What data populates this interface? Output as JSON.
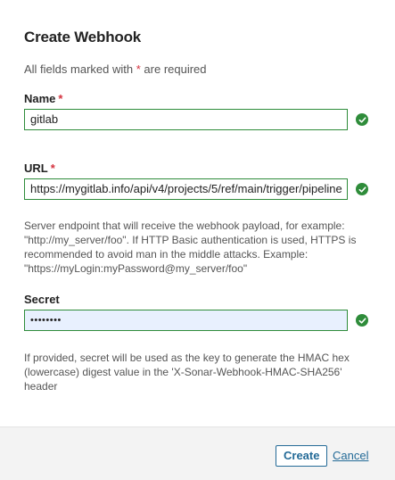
{
  "dialog": {
    "title": "Create Webhook",
    "required_note_prefix": "All fields marked with",
    "required_star": "*",
    "required_note_suffix": "are required"
  },
  "fields": {
    "name": {
      "label": "Name",
      "value": "gitlab",
      "valid_icon": "check-circle-icon"
    },
    "url": {
      "label": "URL",
      "value": "https://mygitlab.info/api/v4/projects/5/ref/main/trigger/pipeline",
      "help": "Server endpoint that will receive the webhook payload, for example: \"http://my_server/foo\". If HTTP Basic authentication is used, HTTPS is recommended to avoid man in the middle attacks. Example: \"https://myLogin:myPassword@my_server/foo\"",
      "valid_icon": "check-circle-icon"
    },
    "secret": {
      "label": "Secret",
      "value": "••••••••",
      "help": "If provided, secret will be used as the key to generate the HMAC hex (lowercase) digest value in the 'X-Sonar-Webhook-HMAC-SHA256' header",
      "valid_icon": "check-circle-icon"
    }
  },
  "footer": {
    "create_label": "Create",
    "cancel_label": "Cancel"
  },
  "colors": {
    "valid": "#2e8c3a",
    "required": "#d4333f",
    "link": "#236a97"
  }
}
